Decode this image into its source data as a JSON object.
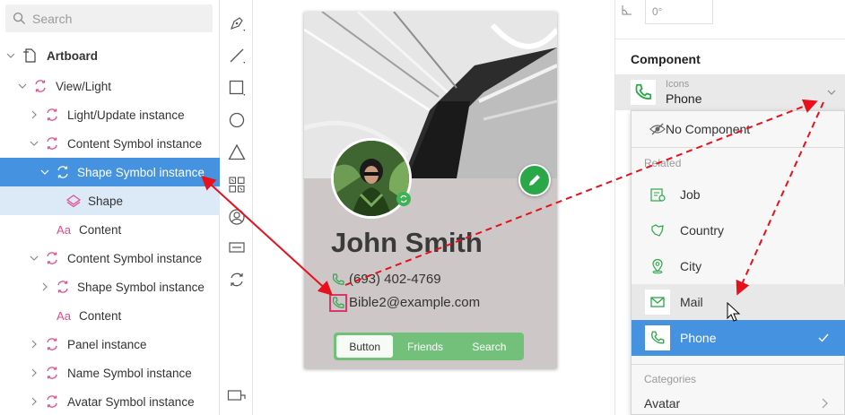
{
  "layers_panel": {
    "search": {
      "placeholder": "Search"
    },
    "items": [
      {
        "label": "Artboard"
      },
      {
        "label": "View/Light"
      },
      {
        "label": "Light/Update instance"
      },
      {
        "label": "Content Symbol instance"
      },
      {
        "label": "Shape Symbol instance"
      },
      {
        "label": "Shape"
      },
      {
        "label": "Content"
      },
      {
        "label": "Content Symbol instance"
      },
      {
        "label": "Shape Symbol instance"
      },
      {
        "label": "Content"
      },
      {
        "label": "Panel instance"
      },
      {
        "label": "Name Symbol instance"
      },
      {
        "label": "Avatar Symbol instance"
      }
    ]
  },
  "card": {
    "name": "John Smith",
    "phone": "(693) 402-4769",
    "email": "Bible2@example.com",
    "tabs": [
      "Button",
      "Friends",
      "Search"
    ]
  },
  "properties": {
    "rotation": "0°",
    "component_title": "Component",
    "component_library": "Icons",
    "component_value": "Phone"
  },
  "component_menu": {
    "no_component": "No Component",
    "related_header": "Related",
    "related_items": [
      "Job",
      "Country",
      "City",
      "Mail",
      "Phone"
    ],
    "categories_header": "Categories",
    "category_items": [
      "Avatar"
    ]
  },
  "colors": {
    "selection_blue": "#4593e0",
    "symbol_pink": "#e14b8c",
    "accent_green": "#2aa847",
    "arrow_red": "#e8101a"
  }
}
